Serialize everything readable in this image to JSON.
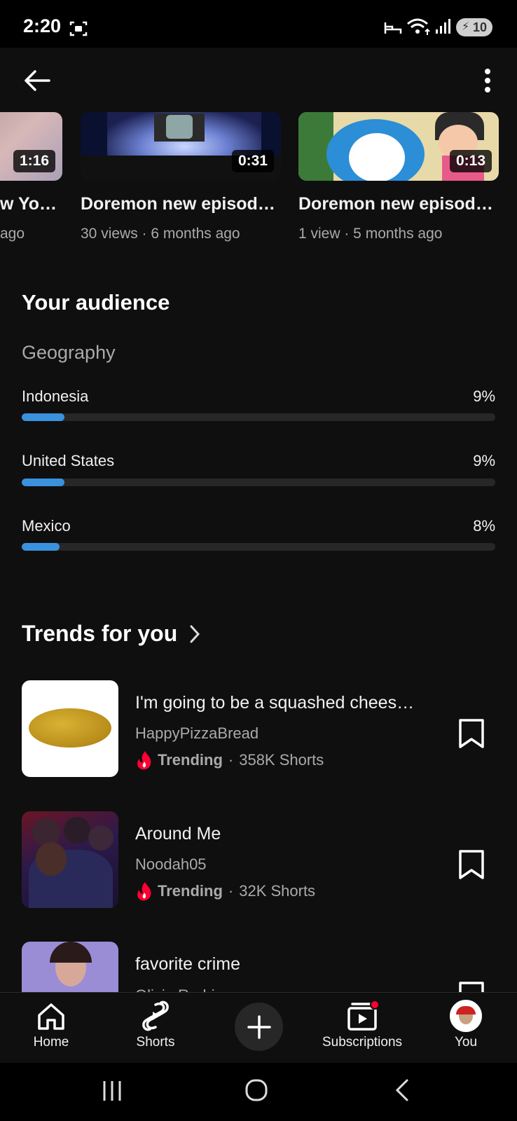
{
  "status_bar": {
    "time": "2:20",
    "battery": "10"
  },
  "videos": [
    {
      "title": "w You…",
      "meta": "ago",
      "duration": "1:16"
    },
    {
      "title": "Doremon new episode…",
      "meta": "30 views · 6 months ago",
      "duration": "0:31"
    },
    {
      "title": "Doremon new episode…",
      "meta": "1 view · 5 months ago",
      "duration": "0:13"
    }
  ],
  "audience": {
    "title": "Your audience",
    "subtitle": "Geography",
    "countries": [
      {
        "name": "Indonesia",
        "pct_label": "9%",
        "share": 0.09
      },
      {
        "name": "United States",
        "pct_label": "9%",
        "share": 0.09
      },
      {
        "name": "Mexico",
        "pct_label": "8%",
        "share": 0.08
      }
    ]
  },
  "trends": {
    "title": "Trends for you",
    "items": [
      {
        "title": "I'm going to be a squashed chees…",
        "channel": "HappyPizzaBread",
        "badge": "Trending",
        "count": "358K Shorts"
      },
      {
        "title": "Around Me",
        "channel": "Noodah05",
        "badge": "Trending",
        "count": "32K Shorts"
      },
      {
        "title": "favorite crime",
        "channel": "Olivia Rodrigo",
        "badge": "",
        "count": ""
      }
    ]
  },
  "nav": {
    "home": "Home",
    "shorts": "Shorts",
    "subscriptions": "Subscriptions",
    "you": "You"
  },
  "icons": {
    "back": "arrow-left-icon",
    "more": "more-vert-icon",
    "bookmark": "bookmark-icon",
    "trending": "flame-icon"
  },
  "colors": {
    "background": "#0f0f0f",
    "accent_bar": "#3ea6ff",
    "trending_red": "#ff0033",
    "notification_dot": "#ff0033"
  }
}
